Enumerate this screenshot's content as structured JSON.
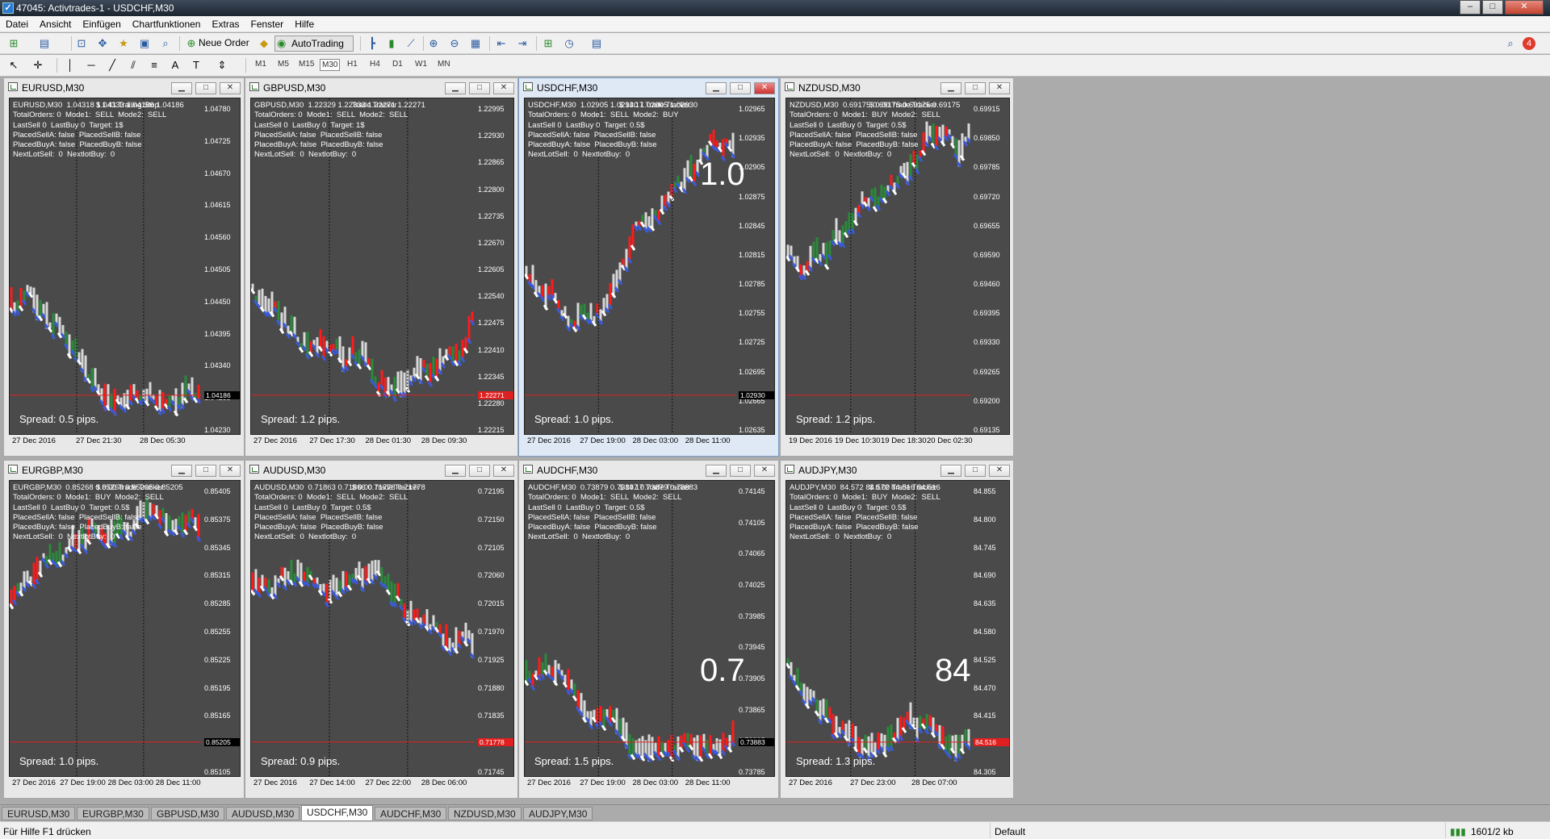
{
  "window": {
    "title": "47045: Activtrades-1 - USDCHF,M30"
  },
  "menu": [
    "Datei",
    "Ansicht",
    "Einfügen",
    "Chartfunktionen",
    "Extras",
    "Fenster",
    "Hilfe"
  ],
  "toolbar": {
    "new_order": "Neue Order",
    "autotrading": "AutoTrading",
    "badge": "4"
  },
  "timeframes": [
    "M1",
    "M5",
    "M15",
    "M30",
    "H1",
    "H4",
    "D1",
    "W1",
    "MN"
  ],
  "selected_timeframe": "M30",
  "charts": [
    {
      "title": "EURUSD,M30",
      "header": "EURUSD,M30  1.04318 1.04333 1.04186 1.04186",
      "extra": "$ 1.41 Trailing Stop",
      "overlay": [
        "TotalOrders: 0  Mode1:  SELL  Mode2:  SELL",
        "LastSell 0  LastBuy 0  Target: 1$",
        "PlacedSellA: false  PlacedSellB: false",
        "PlacedBuyA: false  PlacedBuyB: false",
        "NextLotSell:  0  NextlotBuy:  0"
      ],
      "spread": "Spread: 0.5 pips.",
      "prices": [
        "1.04780",
        "1.04725",
        "1.04670",
        "1.04615",
        "1.04560",
        "1.04505",
        "1.04450",
        "1.04395",
        "1.04340",
        "1.04285",
        "1.04230"
      ],
      "current_price": "1.04186",
      "times": [
        "27 Dec 2016",
        "27 Dec 21:30",
        "28 Dec 05:30"
      ],
      "big": "",
      "color": "#ff2b2b"
    },
    {
      "title": "GBPUSD,M30",
      "header": "GBPUSD,M30  1.22329 1.22333 1.22271 1.22271",
      "extra": "Trade Tracker",
      "overlay": [
        "TotalOrders: 0  Mode1:  SELL  Mode2:  SELL",
        "LastSell 0  LastBuy 0  Target: 1$",
        "PlacedSellA: false  PlacedSellB: false",
        "PlacedBuyA: false  PlacedBuyB: false",
        "NextLotSell:  0  NextlotBuy:  0"
      ],
      "spread": "Spread: 1.2 pips.",
      "prices": [
        "1.22995",
        "1.22930",
        "1.22865",
        "1.22800",
        "1.22735",
        "1.22670",
        "1.22605",
        "1.22540",
        "1.22475",
        "1.22410",
        "1.22345",
        "1.22280",
        "1.22215"
      ],
      "current_price": "1.22271",
      "times": [
        "27 Dec 2016",
        "27 Dec 17:30",
        "28 Dec 01:30",
        "28 Dec 09:30"
      ],
      "big": "",
      "color": "#ff2b2b"
    },
    {
      "title": "USDCHF,M30",
      "header": "USDCHF,M30  1.02905 1.02930 1.02905 1.02930",
      "extra": "$ 14.17 Trade Tracker",
      "overlay": [
        "TotalOrders: 0  Mode1:  SELL  Mode2:  BUY",
        "LastSell 0  LastBuy 0  Target: 0.5$",
        "PlacedSellA: false  PlacedSellB: false",
        "PlacedBuyA: false  PlacedBuyB: false",
        "NextLotSell:  0  NextlotBuy:  0"
      ],
      "spread": "Spread: 1.0 pips.",
      "prices": [
        "1.02965",
        "1.02935",
        "1.02905",
        "1.02875",
        "1.02845",
        "1.02815",
        "1.02785",
        "1.02755",
        "1.02725",
        "1.02695",
        "1.02665",
        "1.02635"
      ],
      "current_price": "1.02930",
      "times": [
        "27 Dec 2016",
        "27 Dec 19:00",
        "28 Dec 03:00",
        "28 Dec 11:00"
      ],
      "big": "1.0",
      "color": "#ff2b2b"
    },
    {
      "title": "NZDUSD,M30",
      "header": "NZDUSD,M30  0.69175 0.69175 0.69175 0.69175",
      "extra": "$ 0.00 Trade Tracker",
      "overlay": [
        "TotalOrders: 0  Mode1:  BUY  Mode2:  SELL",
        "LastSell 0  LastBuy 0  Target: 0.5$",
        "PlacedSellA: false  PlacedSellB: false",
        "PlacedBuyA: false  PlacedBuyB: false",
        "NextLotSell:  0  NextlotBuy:  0"
      ],
      "spread": "Spread: 1.2 pips.",
      "prices": [
        "0.69915",
        "0.69850",
        "0.69785",
        "0.69720",
        "0.69655",
        "0.69590",
        "0.69460",
        "0.69395",
        "0.69330",
        "0.69265",
        "0.69200",
        "0.69135"
      ],
      "current_price": "",
      "times": [
        "19 Dec 2016",
        "19 Dec 10:30",
        "19 Dec 18:30",
        "20 Dec 02:30"
      ],
      "big": "",
      "color": "#ff2b2b"
    },
    {
      "title": "EURGBP,M30",
      "header": "EURGBP,M30  0.85268 0.85268 0.85205 0.85205",
      "extra": "$ 0.00 Trade Tracker",
      "overlay": [
        "TotalOrders: 0  Mode1:  BUY  Mode2:  SELL",
        "LastSell 0  LastBuy 0  Target: 0.5$",
        "PlacedSellA: false  PlacedSellB: false",
        "PlacedBuyA: false  PlacedBuyB: false",
        "NextLotSell:  0  NextlotBuy:  0"
      ],
      "spread": "Spread: 1.0 pips.",
      "prices": [
        "0.85405",
        "0.85375",
        "0.85345",
        "0.85315",
        "0.85285",
        "0.85255",
        "0.85225",
        "0.85195",
        "0.85165",
        "0.85135",
        "0.85105"
      ],
      "current_price": "0.85205",
      "times": [
        "27 Dec 2016",
        "27 Dec 19:00",
        "28 Dec 03:00",
        "28 Dec 11:00"
      ],
      "big": "",
      "color": "#ff2b2b"
    },
    {
      "title": "AUDUSD,M30",
      "header": "AUDUSD,M30  0.71863 0.71866 0.71778 0.71778",
      "extra": "$ 0.00 Trade Tracker",
      "overlay": [
        "TotalOrders: 0  Mode1:  SELL  Mode2:  SELL",
        "LastSell 0  LastBuy 0  Target: 0.5$",
        "PlacedSellA: false  PlacedSellB: false",
        "PlacedBuyA: false  PlacedBuyB: false",
        "NextLotSell:  0  NextlotBuy:  0"
      ],
      "spread": "Spread: 0.9 pips.",
      "prices": [
        "0.72195",
        "0.72150",
        "0.72105",
        "0.72060",
        "0.72015",
        "0.71970",
        "0.71925",
        "0.71880",
        "0.71835",
        "0.71790",
        "0.71745"
      ],
      "current_price": "0.71778",
      "times": [
        "27 Dec 2016",
        "27 Dec 14:00",
        "27 Dec 22:00",
        "28 Dec 06:00"
      ],
      "big": "",
      "color": "#ff2b2b"
    },
    {
      "title": "AUDCHF,M30",
      "header": "AUDCHF,M30  0.73879 0.73897 0.73879 0.73883",
      "extra": "$ 14.17 Trade Tracker",
      "overlay": [
        "TotalOrders: 0  Mode1:  SELL  Mode2:  SELL",
        "LastSell 0  LastBuy 0  Target: 0.5$",
        "PlacedSellA: false  PlacedSellB: false",
        "PlacedBuyA: false  PlacedBuyB: false",
        "NextLotSell:  0  NextlotBuy:  0"
      ],
      "spread": "Spread: 1.5 pips.",
      "prices": [
        "0.74145",
        "0.74105",
        "0.74065",
        "0.74025",
        "0.73985",
        "0.73945",
        "0.73905",
        "0.73865",
        "0.73825",
        "0.73785"
      ],
      "current_price": "0.73883",
      "times": [
        "27 Dec 2016",
        "27 Dec 19:00",
        "28 Dec 03:00",
        "28 Dec 11:00"
      ],
      "big": "0.7",
      "color": "#ff2b2b"
    },
    {
      "title": "AUDJPY,M30",
      "header": "AUDJPY,M30  84.572 84.572 84.516 84.516",
      "extra": "$ 0.00 Trade Tracker",
      "overlay": [
        "TotalOrders: 0  Mode1:  BUY  Mode2:  SELL",
        "LastSell 0  LastBuy 0  Target: 0.5$",
        "PlacedSellA: false  PlacedSellB: false",
        "PlacedBuyA: false  PlacedBuyB: false",
        "NextLotSell:  0  NextlotBuy:  0"
      ],
      "spread": "Spread: 1.3 pips.",
      "prices": [
        "84.855",
        "84.800",
        "84.745",
        "84.690",
        "84.635",
        "84.580",
        "84.525",
        "84.470",
        "84.415",
        "84.360",
        "84.305"
      ],
      "current_price": "84.516",
      "times": [
        "27 Dec 2016",
        "27 Dec 23:00",
        "28 Dec 07:00"
      ],
      "big": "84",
      "color": "#ff2b2b"
    }
  ],
  "tabs": [
    "EURUSD,M30",
    "EURGBP,M30",
    "GBPUSD,M30",
    "AUDUSD,M30",
    "USDCHF,M30",
    "AUDCHF,M30",
    "NZDUSD,M30",
    "AUDJPY,M30"
  ],
  "active_tab": "USDCHF,M30",
  "status": {
    "help": "Für Hilfe F1 drücken",
    "profile": "Default",
    "traffic": "1601/2 kb"
  }
}
